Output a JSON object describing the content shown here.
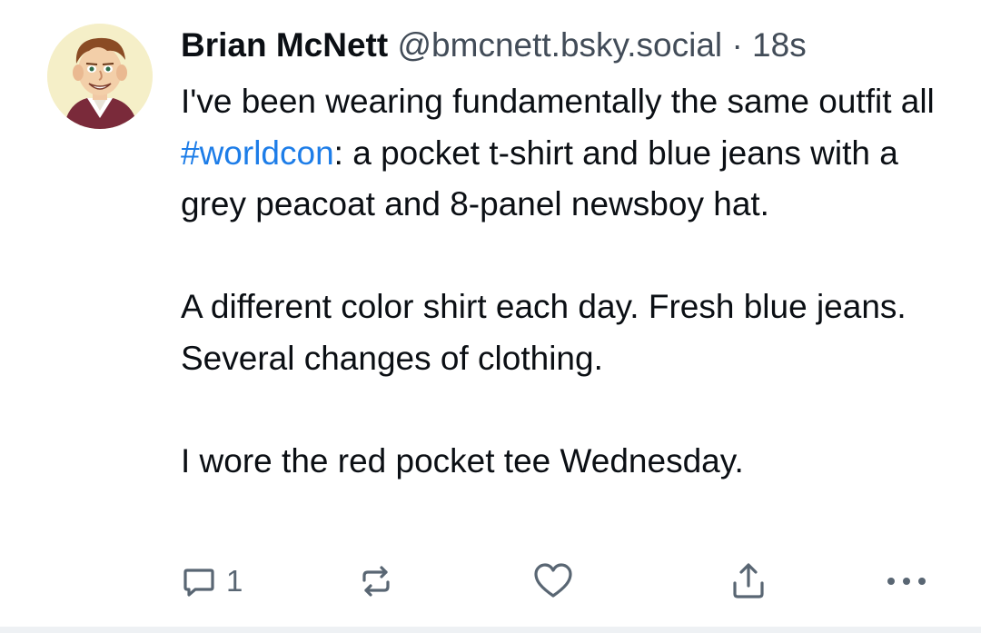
{
  "post": {
    "author_name": "Brian McNett",
    "handle": "@bmcnett.bsky.social",
    "separator": "·",
    "time": "18s",
    "avatar": "cartoon-man-avatar",
    "body": {
      "line1": "I've been wearing fundamentally the same outfit all ",
      "hashtag": "#worldcon",
      "line1_rest": ": a pocket t-shirt and blue jeans with a grey peacoat and 8-panel newsboy hat.",
      "paragraph2": "A different color shirt each day. Fresh blue jeans. Several changes of clothing.",
      "paragraph3": "I wore the red pocket tee Wednesday."
    },
    "actions": {
      "reply_icon": "speech-bubble-icon",
      "reply_count": "1",
      "repost_icon": "repost-icon",
      "like_icon": "heart-icon",
      "share_icon": "share-icon",
      "more_icon": "ellipsis-icon"
    }
  },
  "colors": {
    "text": "#0b0f14",
    "muted": "#424c58",
    "hashtag": "#1d7de8",
    "icon": "#596673"
  }
}
